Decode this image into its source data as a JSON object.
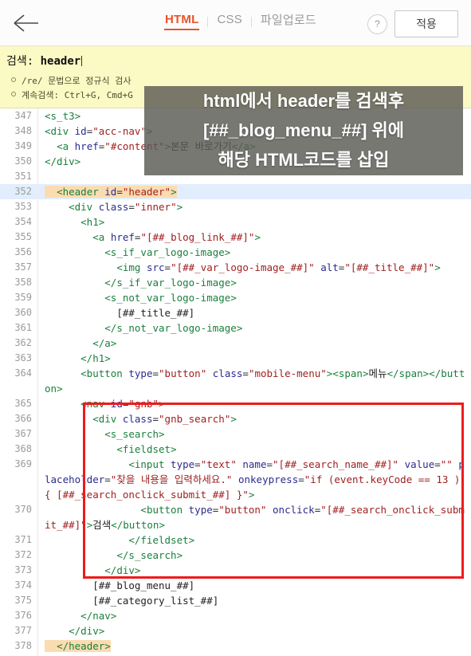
{
  "toolbar": {
    "back_icon": "arrow-left-icon",
    "tabs": [
      {
        "label": "HTML",
        "active": true
      },
      {
        "label": "CSS",
        "active": false
      },
      {
        "label": "파일업로드",
        "active": false
      }
    ],
    "help_label": "?",
    "apply_label": "적용"
  },
  "search": {
    "label": "검색: ",
    "value": "header",
    "hints": [
      "/re/ 문법으로 정규식 검사",
      "계속검색: Ctrl+G, Cmd+G"
    ]
  },
  "annotation": {
    "lines": [
      "html에서 header를 검색후",
      "[##_blog_menu_##] 위에",
      "해당 HTML코드를 삽입"
    ],
    "box_color": "#ee1b1b",
    "overlay_color": "#5a5a54"
  },
  "editor": {
    "language": "HTML",
    "colors": {
      "tag": "#1a7f3c",
      "attribute": "#2b2b8f",
      "value": "#a02020",
      "active_line": "#e2eefd",
      "search_match": "#fbdcb0"
    },
    "lines": [
      {
        "num": "347",
        "text": "<s_t3>"
      },
      {
        "num": "348",
        "text": "<div id=\"acc-nav\">"
      },
      {
        "num": "349",
        "text": "  <a href=\"#content\">본문 바로가기</a>"
      },
      {
        "num": "350",
        "text": "</div>"
      },
      {
        "num": "351",
        "text": ""
      },
      {
        "num": "352",
        "text": "  <header id=\"header\">"
      },
      {
        "num": "353",
        "text": "    <div class=\"inner\">"
      },
      {
        "num": "354",
        "text": "      <h1>"
      },
      {
        "num": "355",
        "text": "        <a href=\"[##_blog_link_##]\">"
      },
      {
        "num": "356",
        "text": "          <s_if_var_logo-image>"
      },
      {
        "num": "357",
        "text": "            <img src=\"[##_var_logo-image_##]\" alt=\"[##_title_##]\">"
      },
      {
        "num": "358",
        "text": "          </s_if_var_logo-image>"
      },
      {
        "num": "359",
        "text": "          <s_not_var_logo-image>"
      },
      {
        "num": "360",
        "text": "            [##_title_##]"
      },
      {
        "num": "361",
        "text": "          </s_not_var_logo-image>"
      },
      {
        "num": "362",
        "text": "        </a>"
      },
      {
        "num": "363",
        "text": "      </h1>"
      },
      {
        "num": "364",
        "text": "      <button type=\"button\" class=\"mobile-menu\"><span>메뉴</span></button>"
      },
      {
        "num": "365",
        "text": "      <nav id=\"gnb\">"
      },
      {
        "num": "366",
        "text": "        <div class=\"gnb_search\">"
      },
      {
        "num": "367",
        "text": "          <s_search>"
      },
      {
        "num": "368",
        "text": "            <fieldset>"
      },
      {
        "num": "369",
        "text": "              <input type=\"text\" name=\"[##_search_name_##]\" value=\"\" placeholder=\"찾을 내용을 입력하세요.\" onkeypress=\"if (event.keyCode == 13 ) { [##_search_onclick_submit_##] }\">"
      },
      {
        "num": "370",
        "text": "                <button type=\"button\" onclick=\"[##_search_onclick_submit_##]\">검색</button>"
      },
      {
        "num": "371",
        "text": "              </fieldset>"
      },
      {
        "num": "372",
        "text": "            </s_search>"
      },
      {
        "num": "373",
        "text": "          </div>"
      },
      {
        "num": "374",
        "text": "        [##_blog_menu_##]"
      },
      {
        "num": "375",
        "text": "        [##_category_list_##]"
      },
      {
        "num": "376",
        "text": "      </nav>"
      },
      {
        "num": "377",
        "text": "    </div>"
      },
      {
        "num": "378",
        "text": "  </header>"
      }
    ]
  }
}
